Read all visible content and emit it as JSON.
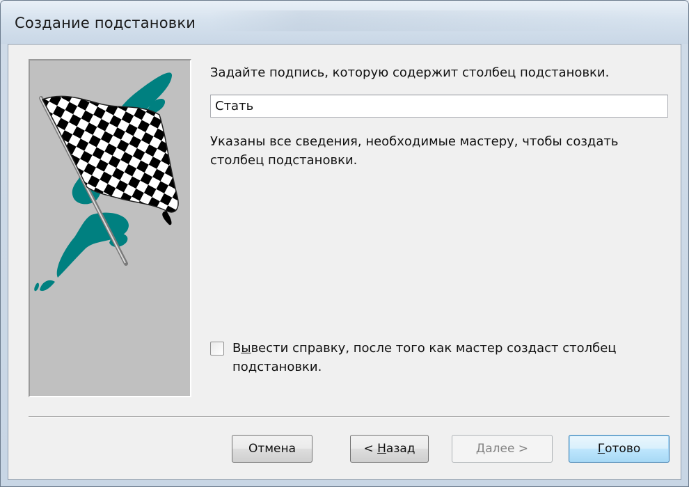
{
  "window": {
    "title": "Создание подстановки"
  },
  "main": {
    "prompt": "Задайте подпись, которую содержит столбец подстановки.",
    "caption_value": "Стать",
    "info_text": "Указаны все сведения, необходимые мастеру, чтобы создать столбец подстановки.",
    "help_checkbox": {
      "checked": false,
      "label_prefix": "В",
      "label_mnemonic": "ы",
      "label_rest": "вести справку, после того как мастер создаст столбец подстановки."
    }
  },
  "buttons": {
    "cancel": {
      "label": "Отмена"
    },
    "back": {
      "prefix": "< ",
      "mnemonic": "Н",
      "rest": "азад"
    },
    "next": {
      "mnemonic": "Д",
      "rest": "алее >",
      "enabled": false
    },
    "finish": {
      "mnemonic": "Г",
      "rest": "отово"
    }
  },
  "colors": {
    "art_background": "#c0c0c0",
    "art_accent": "#008080",
    "default_button_border": "#3c7fb1"
  },
  "icons": {
    "wizard_art": "checkered-flag-icon"
  }
}
